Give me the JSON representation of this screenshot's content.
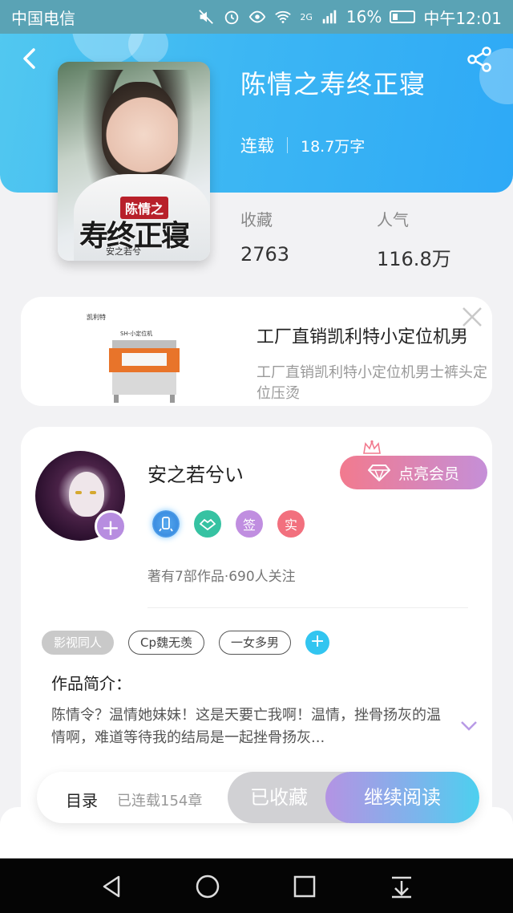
{
  "status_bar": {
    "carrier": "中国电信",
    "network": "2G",
    "battery": "16%",
    "time": "中午12:01"
  },
  "book": {
    "title": "陈情之寿终正寝",
    "status": "连载",
    "word_count": "18.7万字",
    "collect_label": "收藏",
    "collect_value": "2763",
    "popularity_label": "人气",
    "popularity_value": "116.8万",
    "cover": {
      "tag": "陈情之",
      "title": "寿终正寝",
      "author": "安之若兮"
    }
  },
  "ad": {
    "title": "工厂直销凯利特小定位机男",
    "description": "工厂直销凯利特小定位机男士裤头定位压烫",
    "image_brand": "凯利特",
    "image_model": "SH-小定位机"
  },
  "author": {
    "name": "安之若兮い",
    "vip_label": "点亮会员",
    "badges": [
      "",
      "",
      "签",
      "实"
    ],
    "stats": "著有7部作品·690人关注",
    "tags": [
      "影视同人",
      "Cp魏无羡",
      "一女多男"
    ],
    "intro_label": "作品简介：",
    "intro_text": "陈情令？温情她妹妹！这是天要亡我啊！温情，挫骨扬灰的温情啊，难道等待我的结局是一起挫骨扬灰..."
  },
  "bottom_bar": {
    "toc_label": "目录",
    "chapters": "已连载154章",
    "collected_label": "已收藏",
    "read_label": "继续阅读"
  },
  "colors": {
    "header_blue": "#3db7f3",
    "vip_gradient_start": "#f27a8e",
    "read_gradient_end": "#4cd0ef"
  }
}
